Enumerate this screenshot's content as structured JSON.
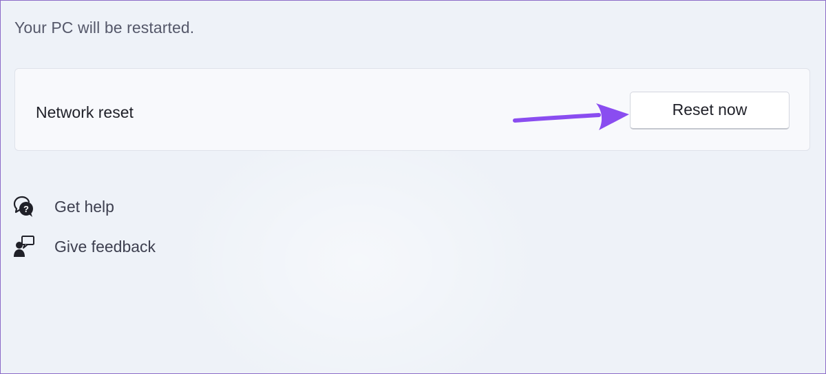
{
  "description": "Your PC will be restarted.",
  "network_reset": {
    "title": "Network reset",
    "button_label": "Reset now",
    "arrow_color": "#8a4df0"
  },
  "links": {
    "help": {
      "label": "Get help",
      "icon": "help-chat-icon"
    },
    "feedback": {
      "label": "Give feedback",
      "icon": "feedback-person-icon"
    }
  },
  "colors": {
    "background": "#eef2f8",
    "card": "#f8f9fc",
    "frame_border": "#8c6bc8"
  }
}
